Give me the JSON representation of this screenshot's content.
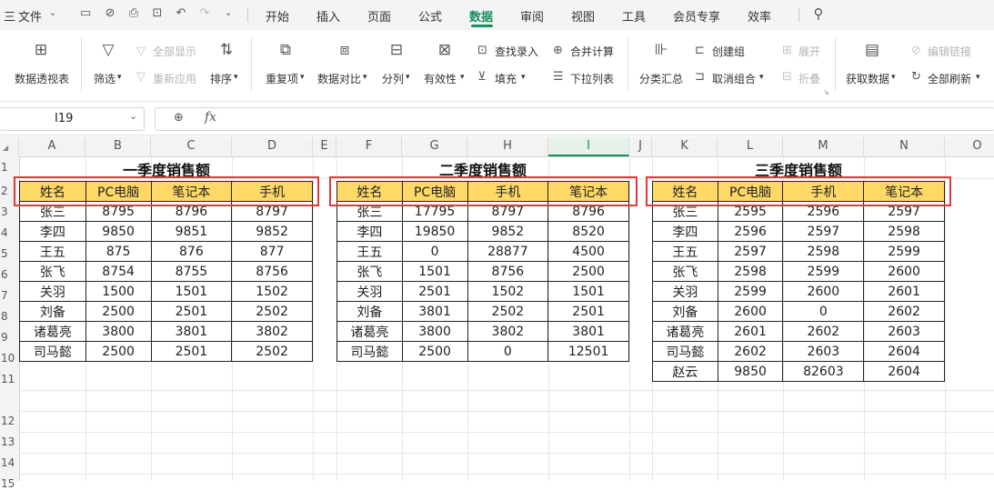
{
  "menubar": {
    "hamburger": "三",
    "file": "文件",
    "tabs": [
      "开始",
      "插入",
      "页面",
      "公式",
      "数据",
      "审阅",
      "视图",
      "工具",
      "会员专享",
      "效率"
    ],
    "active_tab": "数据"
  },
  "ribbon": {
    "pivot": "数据透视表",
    "filter": "筛选",
    "show_all": "全部显示",
    "reapply": "重新应用",
    "sort": "排序",
    "duplicates": "重复项",
    "compare": "数据对比",
    "split": "分列",
    "validity": "有效性",
    "find_entry": "查找录入",
    "fill": "填充",
    "consolidate": "合并计算",
    "dropdown_list": "下拉列表",
    "subtotal": "分类汇总",
    "create_group": "创建组",
    "ungroup": "取消组合",
    "expand": "展开",
    "collapse": "折叠",
    "get_data": "获取数据",
    "edit_links": "编辑链接",
    "refresh_all": "全部刷新"
  },
  "formula_bar": {
    "cell_ref": "I19",
    "fx": "fx",
    "formula": ""
  },
  "columns": [
    "A",
    "B",
    "C",
    "D",
    "E",
    "F",
    "G",
    "H",
    "I",
    "J",
    "K",
    "L",
    "M",
    "N",
    "O"
  ],
  "selected_column": "I",
  "rows": [
    "1",
    "2",
    "3",
    "4",
    "5",
    "6",
    "7",
    "8",
    "9",
    "10",
    "11",
    "12",
    "13",
    "14",
    "15"
  ],
  "tables": [
    {
      "title": "一季度销售额",
      "headers": [
        "姓名",
        "PC电脑",
        "笔记本",
        "手机"
      ],
      "rows": [
        [
          "张三",
          "8795",
          "8796",
          "8797"
        ],
        [
          "李四",
          "9850",
          "9851",
          "9852"
        ],
        [
          "王五",
          "875",
          "876",
          "877"
        ],
        [
          "张飞",
          "8754",
          "8755",
          "8756"
        ],
        [
          "关羽",
          "1500",
          "1501",
          "1502"
        ],
        [
          "刘备",
          "2500",
          "2501",
          "2502"
        ],
        [
          "诸葛亮",
          "3800",
          "3801",
          "3802"
        ],
        [
          "司马懿",
          "2500",
          "2501",
          "2502"
        ]
      ]
    },
    {
      "title": "二季度销售额",
      "headers": [
        "姓名",
        "PC电脑",
        "手机",
        "笔记本"
      ],
      "rows": [
        [
          "张三",
          "17795",
          "8797",
          "8796"
        ],
        [
          "李四",
          "19850",
          "9852",
          "8520"
        ],
        [
          "王五",
          "0",
          "28877",
          "4500"
        ],
        [
          "张飞",
          "1501",
          "8756",
          "2500"
        ],
        [
          "关羽",
          "2501",
          "1502",
          "1501"
        ],
        [
          "刘备",
          "3801",
          "2502",
          "2501"
        ],
        [
          "诸葛亮",
          "3800",
          "3802",
          "3801"
        ],
        [
          "司马懿",
          "2500",
          "0",
          "12501"
        ]
      ]
    },
    {
      "title": "三季度销售额",
      "headers": [
        "姓名",
        "PC电脑",
        "手机",
        "笔记本"
      ],
      "rows": [
        [
          "张三",
          "2595",
          "2596",
          "2597"
        ],
        [
          "李四",
          "2596",
          "2597",
          "2598"
        ],
        [
          "王五",
          "2597",
          "2598",
          "2599"
        ],
        [
          "张飞",
          "2598",
          "2599",
          "2600"
        ],
        [
          "关羽",
          "2599",
          "2600",
          "2601"
        ],
        [
          "刘备",
          "2600",
          "0",
          "2602"
        ],
        [
          "诸葛亮",
          "2601",
          "2602",
          "2603"
        ],
        [
          "司马懿",
          "2602",
          "2603",
          "2604"
        ],
        [
          "赵云",
          "9850",
          "82603",
          "2604"
        ]
      ]
    }
  ],
  "colors": {
    "accent": "#1a8f5c",
    "header_fill": "#ffd966",
    "highlight_box": "#e03a3a"
  }
}
